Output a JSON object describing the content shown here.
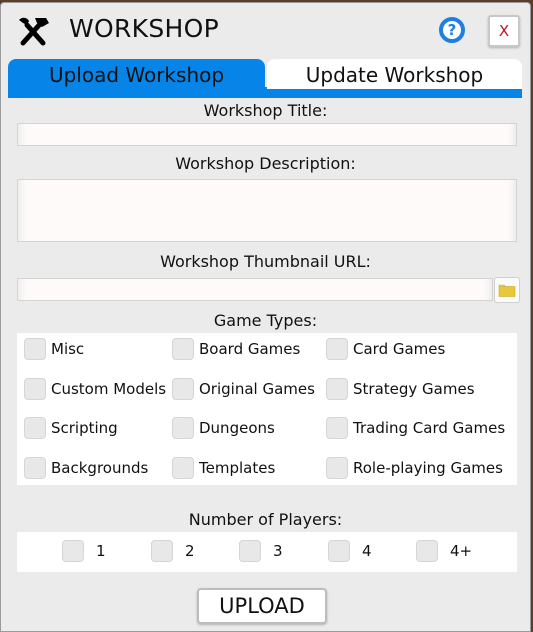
{
  "window": {
    "title": "WORKSHOP",
    "icon": "tools-icon",
    "help_label": "?",
    "close_label": "X"
  },
  "tabs": [
    {
      "label": "Upload Workshop",
      "active": true
    },
    {
      "label": "Update Workshop",
      "active": false
    }
  ],
  "form": {
    "title_label": "Workshop Title:",
    "title_value": "",
    "description_label": "Workshop Description:",
    "description_value": "",
    "thumbnail_label": "Workshop Thumbnail URL:",
    "thumbnail_value": "",
    "folder_icon": "folder-icon",
    "game_types_label": "Game Types:",
    "game_types": [
      {
        "label": "Misc",
        "checked": false
      },
      {
        "label": "Board Games",
        "checked": false
      },
      {
        "label": "Card Games",
        "checked": false
      },
      {
        "label": "Custom Models",
        "checked": false
      },
      {
        "label": "Original Games",
        "checked": false
      },
      {
        "label": "Strategy Games",
        "checked": false
      },
      {
        "label": "Scripting",
        "checked": false
      },
      {
        "label": "Dungeons",
        "checked": false
      },
      {
        "label": "Trading Card Games",
        "checked": false
      },
      {
        "label": "Backgrounds",
        "checked": false
      },
      {
        "label": "Templates",
        "checked": false
      },
      {
        "label": "Role-playing Games",
        "checked": false
      }
    ],
    "players_label": "Number of Players:",
    "players": [
      {
        "label": "1",
        "checked": false
      },
      {
        "label": "2",
        "checked": false
      },
      {
        "label": "3",
        "checked": false
      },
      {
        "label": "4",
        "checked": false
      },
      {
        "label": "4+",
        "checked": false
      }
    ],
    "upload_label": "UPLOAD"
  },
  "colors": {
    "accent": "#0784e8",
    "help": "#1e7fe0",
    "close": "#c0151b",
    "folder": "#e6c83a"
  }
}
